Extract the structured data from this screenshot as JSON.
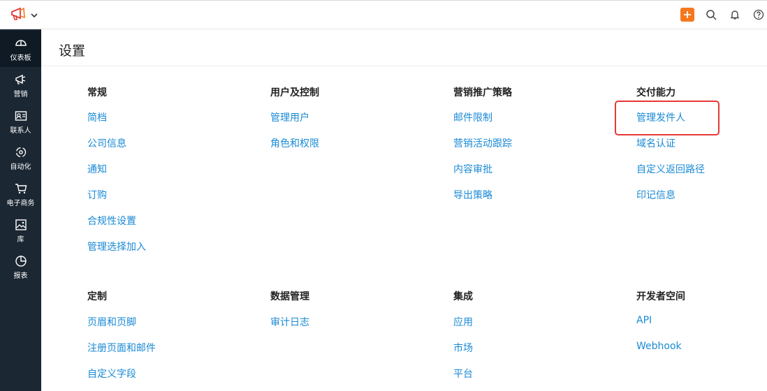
{
  "page": {
    "title": "设置"
  },
  "sidebar": {
    "items": [
      {
        "label": "仪表板",
        "icon": "dashboard-icon"
      },
      {
        "label": "营销",
        "icon": "megaphone-icon"
      },
      {
        "label": "联系人",
        "icon": "contact-card-icon"
      },
      {
        "label": "自动化",
        "icon": "automation-icon"
      },
      {
        "label": "电子商务",
        "icon": "cart-icon"
      },
      {
        "label": "库",
        "icon": "gallery-icon"
      },
      {
        "label": "报表",
        "icon": "pie-chart-icon"
      }
    ]
  },
  "topbar": {
    "icons": [
      "megaphone-logo-icon",
      "chevron-down-icon",
      "plus-icon",
      "search-icon",
      "bell-icon",
      "help-icon"
    ]
  },
  "groups": [
    {
      "title": "常规",
      "links": [
        "简档",
        "公司信息",
        "通知",
        "订购",
        "合规性设置",
        "管理选择加入"
      ]
    },
    {
      "title": "用户及控制",
      "links": [
        "管理用户",
        "角色和权限"
      ]
    },
    {
      "title": "营销推广策略",
      "links": [
        "邮件限制",
        "营销活动跟踪",
        "内容审批",
        "导出策略"
      ]
    },
    {
      "title": "交付能力",
      "links": [
        "管理发件人",
        "域名认证",
        "自定义返回路径",
        "印记信息"
      ]
    },
    {
      "title": "定制",
      "links": [
        "页眉和页脚",
        "注册页面和邮件",
        "自定义字段"
      ]
    },
    {
      "title": "数据管理",
      "links": [
        "审计日志"
      ]
    },
    {
      "title": "集成",
      "links": [
        "应用",
        "市场",
        "平台"
      ]
    },
    {
      "title": "开发者空间",
      "links": [
        "API",
        "Webhook"
      ]
    }
  ],
  "colors": {
    "accent": "#f5781f",
    "link": "#1a8ad4",
    "sidebar": "#1b2733",
    "highlight": "#e53935"
  }
}
